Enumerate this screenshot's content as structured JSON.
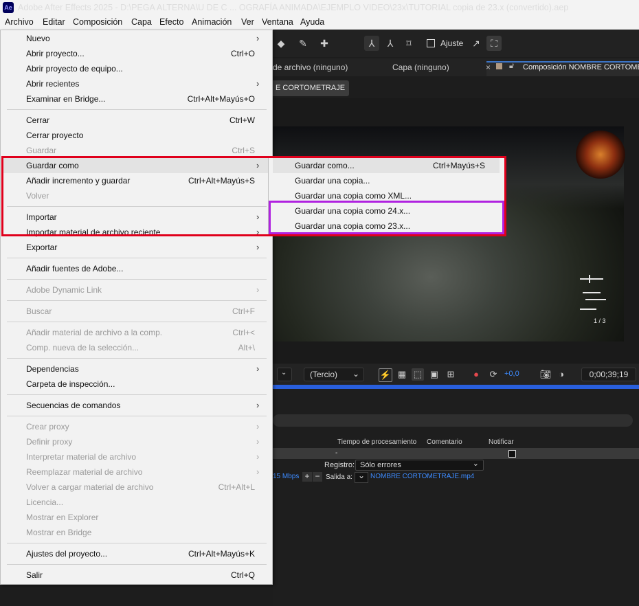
{
  "window": {
    "app_icon": "Ae",
    "title": "Adobe After Effects 2025 - D:\\PEGA ALTERNA\\U DE C ... OGRAFÍA ANIMADA\\EJEMPLO VIDEO\\23x\\TUTORIAL copia de 23.x (convertido).aep"
  },
  "menubar": [
    "Archivo",
    "Editar",
    "Composición",
    "Capa",
    "Efecto",
    "Animación",
    "Ver",
    "Ventana",
    "Ayuda"
  ],
  "toolbar": {
    "ajuste_label": "Ajuste"
  },
  "panels": {
    "source_tab": "de archivo (ninguno)",
    "layer_tab": "Capa (ninguno)",
    "comp_tab": "Composición NOMBRE CORTOMETRAJE",
    "comp_subtab": "E CORTOMETRAJE"
  },
  "viewer": {
    "resolution_dropdown": "(Tercio)",
    "exposure": "+0,0",
    "timecode": "0;00;39;19",
    "hud_ammo": "1 / 3"
  },
  "render_queue": {
    "columns": [
      "Tiempo de procesamiento",
      "Comentario",
      "Notificar"
    ],
    "row_value": "-",
    "registro_label": "Registro:",
    "registro_value": "Sólo errores",
    "bitrate": "15 Mbps",
    "salida_label": "Salida a:",
    "salida_file": "NOMBRE CORTOMETRAJE.mp4"
  },
  "file_menu": {
    "items": [
      {
        "label": "Nuevo",
        "shortcut": "",
        "submenu": true,
        "enabled": true
      },
      {
        "label": "Abrir proyecto...",
        "shortcut": "Ctrl+O",
        "submenu": false,
        "enabled": true
      },
      {
        "label": "Abrir proyecto de equipo...",
        "shortcut": "",
        "submenu": false,
        "enabled": true
      },
      {
        "label": "Abrir recientes",
        "shortcut": "",
        "submenu": true,
        "enabled": true
      },
      {
        "label": "Examinar en Bridge...",
        "shortcut": "Ctrl+Alt+Mayús+O",
        "submenu": false,
        "enabled": true
      },
      {
        "label": "Cerrar",
        "shortcut": "Ctrl+W",
        "submenu": false,
        "enabled": true
      },
      {
        "label": "Cerrar proyecto",
        "shortcut": "",
        "submenu": false,
        "enabled": true
      },
      {
        "label": "Guardar",
        "shortcut": "Ctrl+S",
        "submenu": false,
        "enabled": false
      },
      {
        "label": "Guardar como",
        "shortcut": "",
        "submenu": true,
        "enabled": true
      },
      {
        "label": "Añadir incremento y guardar",
        "shortcut": "Ctrl+Alt+Mayús+S",
        "submenu": false,
        "enabled": true
      },
      {
        "label": "Volver",
        "shortcut": "",
        "submenu": false,
        "enabled": false
      },
      {
        "label": "Importar",
        "shortcut": "",
        "submenu": true,
        "enabled": true
      },
      {
        "label": "Importar material de archivo reciente",
        "shortcut": "",
        "submenu": true,
        "enabled": true
      },
      {
        "label": "Exportar",
        "shortcut": "",
        "submenu": true,
        "enabled": true
      },
      {
        "label": "Añadir fuentes de Adobe...",
        "shortcut": "",
        "submenu": false,
        "enabled": true
      },
      {
        "label": "Adobe Dynamic Link",
        "shortcut": "",
        "submenu": true,
        "enabled": false
      },
      {
        "label": "Buscar",
        "shortcut": "Ctrl+F",
        "submenu": false,
        "enabled": false
      },
      {
        "label": "Añadir material de archivo a la comp.",
        "shortcut": "Ctrl+<",
        "submenu": false,
        "enabled": false
      },
      {
        "label": "Comp. nueva de la selección...",
        "shortcut": "Alt+\\",
        "submenu": false,
        "enabled": false
      },
      {
        "label": "Dependencias",
        "shortcut": "",
        "submenu": true,
        "enabled": true
      },
      {
        "label": "Carpeta de inspección...",
        "shortcut": "",
        "submenu": false,
        "enabled": true
      },
      {
        "label": "Secuencias de comandos",
        "shortcut": "",
        "submenu": true,
        "enabled": true
      },
      {
        "label": "Crear proxy",
        "shortcut": "",
        "submenu": true,
        "enabled": false
      },
      {
        "label": "Definir proxy",
        "shortcut": "",
        "submenu": true,
        "enabled": false
      },
      {
        "label": "Interpretar material de archivo",
        "shortcut": "",
        "submenu": true,
        "enabled": false
      },
      {
        "label": "Reemplazar material de archivo",
        "shortcut": "",
        "submenu": true,
        "enabled": false
      },
      {
        "label": "Volver a cargar material de archivo",
        "shortcut": "Ctrl+Alt+L",
        "submenu": false,
        "enabled": false
      },
      {
        "label": "Licencia...",
        "shortcut": "",
        "submenu": false,
        "enabled": false
      },
      {
        "label": "Mostrar en Explorer",
        "shortcut": "",
        "submenu": false,
        "enabled": false
      },
      {
        "label": "Mostrar en Bridge",
        "shortcut": "",
        "submenu": false,
        "enabled": false
      },
      {
        "label": "Ajustes del proyecto...",
        "shortcut": "Ctrl+Alt+Mayús+K",
        "submenu": false,
        "enabled": true
      },
      {
        "label": "Salir",
        "shortcut": "Ctrl+Q",
        "submenu": false,
        "enabled": true
      }
    ]
  },
  "save_as_submenu": {
    "items": [
      {
        "label": "Guardar como...",
        "shortcut": "Ctrl+Mayús+S"
      },
      {
        "label": "Guardar una copia...",
        "shortcut": ""
      },
      {
        "label": "Guardar una copia como XML...",
        "shortcut": ""
      },
      {
        "label": "Guardar una copia como 24.x...",
        "shortcut": ""
      },
      {
        "label": "Guardar una copia como 23.x...",
        "shortcut": ""
      }
    ]
  },
  "colors": {
    "annotation_red": "#e0001c",
    "annotation_purple": "#b022e0",
    "accent_blue": "#3d8bff"
  }
}
